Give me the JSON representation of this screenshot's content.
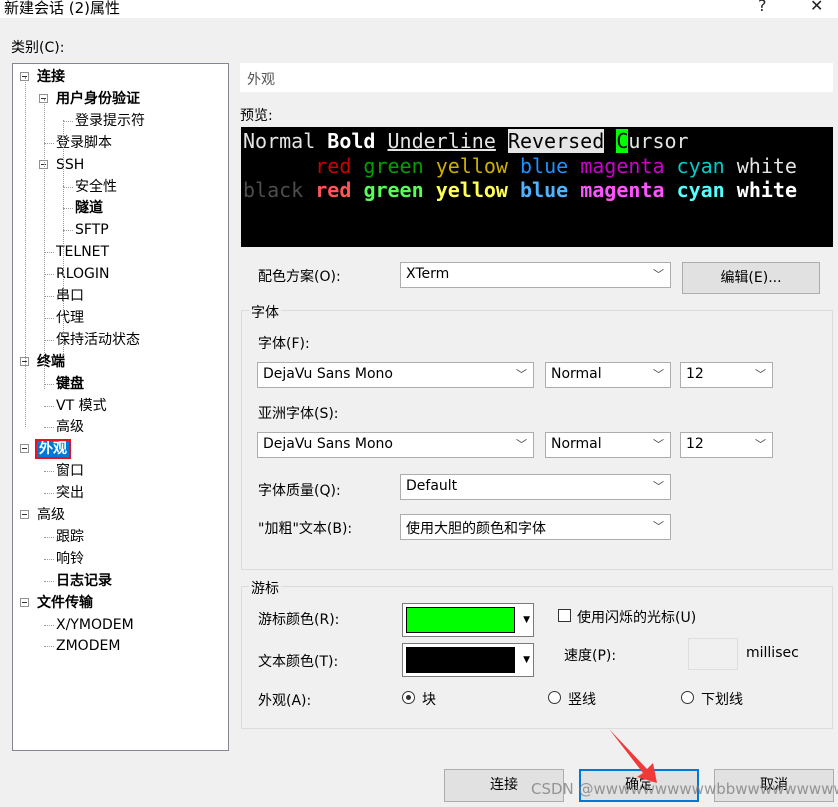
{
  "window": {
    "title": "新建会话 (2)属性",
    "help": "?",
    "close": "✕"
  },
  "category_label": "类别(C):",
  "tree": [
    {
      "label": "连接",
      "level": 0,
      "bold": true,
      "expander": true
    },
    {
      "label": "用户身份验证",
      "level": 1,
      "bold": true,
      "expander": true
    },
    {
      "label": "登录提示符",
      "level": 2
    },
    {
      "label": "登录脚本",
      "level": 1
    },
    {
      "label": "SSH",
      "level": 1,
      "expander": true
    },
    {
      "label": "安全性",
      "level": 2
    },
    {
      "label": "隧道",
      "level": 2,
      "bold": true
    },
    {
      "label": "SFTP",
      "level": 2
    },
    {
      "label": "TELNET",
      "level": 1
    },
    {
      "label": "RLOGIN",
      "level": 1
    },
    {
      "label": "串口",
      "level": 1
    },
    {
      "label": "代理",
      "level": 1
    },
    {
      "label": "保持活动状态",
      "level": 1
    },
    {
      "label": "终端",
      "level": 0,
      "bold": true,
      "expander": true
    },
    {
      "label": "键盘",
      "level": 1,
      "bold": true
    },
    {
      "label": "VT 模式",
      "level": 1
    },
    {
      "label": "高级",
      "level": 1
    },
    {
      "label": "外观",
      "level": 0,
      "bold": true,
      "expander": true,
      "selected": true
    },
    {
      "label": "窗口",
      "level": 1
    },
    {
      "label": "突出",
      "level": 1
    },
    {
      "label": "高级",
      "level": 0,
      "expander": true
    },
    {
      "label": "跟踪",
      "level": 1
    },
    {
      "label": "响铃",
      "level": 1
    },
    {
      "label": "日志记录",
      "level": 1,
      "bold": true
    },
    {
      "label": "文件传输",
      "level": 0,
      "bold": true,
      "expander": true
    },
    {
      "label": "X/YMODEM",
      "level": 1
    },
    {
      "label": "ZMODEM",
      "level": 1
    }
  ],
  "panel": {
    "heading": "外观",
    "preview_label": "预览:"
  },
  "preview": {
    "line1": {
      "normal": "Normal",
      "bold": "Bold",
      "underline": "Underline",
      "reversed": "Reversed",
      "cursor_char": "C",
      "cursor_rest": "ursor"
    },
    "line2": [
      {
        "t": "red",
        "c": "#cd0000"
      },
      {
        "t": "green",
        "c": "#00a000"
      },
      {
        "t": "yellow",
        "c": "#cdb000"
      },
      {
        "t": "blue",
        "c": "#1e90ff"
      },
      {
        "t": "magenta",
        "c": "#cd00cd"
      },
      {
        "t": "cyan",
        "c": "#00cdcd"
      },
      {
        "t": "white",
        "c": "#e5e5e5"
      }
    ],
    "line3": [
      {
        "t": "black",
        "c": "#4d4d4d"
      },
      {
        "t": "red",
        "c": "#ff5555"
      },
      {
        "t": "green",
        "c": "#55ff55"
      },
      {
        "t": "yellow",
        "c": "#ffff55"
      },
      {
        "t": "blue",
        "c": "#4fb4ff"
      },
      {
        "t": "magenta",
        "c": "#ff55ff"
      },
      {
        "t": "cyan",
        "c": "#55ffff"
      },
      {
        "t": "white",
        "c": "#ffffff"
      }
    ],
    "cursor_color": "#00ff00"
  },
  "scheme": {
    "label": "配色方案(O):",
    "value": "XTerm",
    "edit_button": "编辑(E)..."
  },
  "font_group": {
    "title": "字体",
    "font_label": "字体(F):",
    "font": "DejaVu Sans Mono",
    "style": "Normal",
    "size": "12",
    "asian_label": "亚洲字体(S):",
    "asian_font": "DejaVu Sans Mono",
    "asian_style": "Normal",
    "asian_size": "12",
    "quality_label": "字体质量(Q):",
    "quality": "Default",
    "bold_label": "\"加粗\"文本(B):",
    "bold_value": "使用大胆的颜色和字体"
  },
  "cursor_group": {
    "title": "游标",
    "cursor_color_label": "游标颜色(R):",
    "cursor_color": "#00ff00",
    "text_color_label": "文本颜色(T):",
    "text_color": "#000000",
    "blink_label": "使用闪烁的光标(U)",
    "blink_checked": false,
    "speed_label": "速度(P):",
    "speed_value": "",
    "speed_unit": "millisec",
    "shape_label": "外观(A):",
    "shapes": [
      "块",
      "竖线",
      "下划线"
    ],
    "selected_shape": "块"
  },
  "buttons": {
    "connect": "连接",
    "ok": "确定",
    "cancel": "取消"
  },
  "watermark": "CSDN @wwwwwwwwwwbbwwwwwwwwwww"
}
